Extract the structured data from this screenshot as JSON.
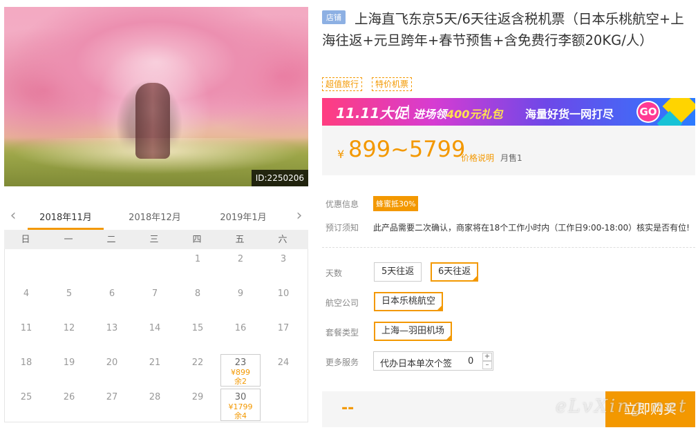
{
  "hero": {
    "id_label": "ID:2250206"
  },
  "calendar": {
    "months": [
      "2018年11月",
      "2018年12月",
      "2019年1月"
    ],
    "active_month": "2018年11月",
    "weekdays": [
      "日",
      "一",
      "二",
      "三",
      "四",
      "五",
      "六"
    ],
    "offset": 4,
    "days": [
      {
        "d": "1"
      },
      {
        "d": "2"
      },
      {
        "d": "3"
      },
      {
        "d": "4"
      },
      {
        "d": "5"
      },
      {
        "d": "6"
      },
      {
        "d": "7"
      },
      {
        "d": "8"
      },
      {
        "d": "9"
      },
      {
        "d": "10"
      },
      {
        "d": "11"
      },
      {
        "d": "12"
      },
      {
        "d": "13"
      },
      {
        "d": "14"
      },
      {
        "d": "15"
      },
      {
        "d": "16"
      },
      {
        "d": "17"
      },
      {
        "d": "18"
      },
      {
        "d": "19"
      },
      {
        "d": "20"
      },
      {
        "d": "21"
      },
      {
        "d": "22"
      },
      {
        "d": "23",
        "price": "¥899",
        "stock": "余2"
      },
      {
        "d": "24"
      },
      {
        "d": "25"
      },
      {
        "d": "26"
      },
      {
        "d": "27"
      },
      {
        "d": "28"
      },
      {
        "d": "29"
      },
      {
        "d": "30",
        "price": "¥1799",
        "stock": "余4"
      }
    ]
  },
  "product": {
    "store_badge": "店铺",
    "title": "上海直飞东京5天/6天往返含税机票（日本乐桃航空+上海往返+元旦跨年+春节预售+含免费行李额20KG/人）",
    "tags": [
      "超值旅行",
      "特价机票"
    ]
  },
  "promo": {
    "big": "11.11大促",
    "mid_prefix": "进场领",
    "mid_amount": "400元礼包",
    "tail": "海量好货一网打尽",
    "go": "GO"
  },
  "price": {
    "currency": "¥",
    "range": "899~5799",
    "explain": "价格说明",
    "sold": "月售1"
  },
  "discount": {
    "label": "优惠信息",
    "badge": "蜂蜜抵30%"
  },
  "notice": {
    "label": "预订须知",
    "text": "此产品需要二次确认，商家将在18个工作小时内（工作日9:00-18:00）核实是否有位!"
  },
  "options": {
    "days": {
      "label": "天数",
      "items": [
        "5天往返",
        "6天往返"
      ],
      "selected": "6天往返"
    },
    "airline": {
      "label": "航空公司",
      "items": [
        "日本乐桃航空"
      ],
      "selected": "日本乐桃航空"
    },
    "package": {
      "label": "套餐类型",
      "items": [
        "上海—羽田机场"
      ],
      "selected": "上海—羽田机场"
    },
    "service": {
      "label": "更多服务",
      "name": "代办日本单次个签",
      "qty": "0",
      "plus": "+",
      "minus": "–"
    }
  },
  "bottom": {
    "total": "--",
    "buy": "立即购买",
    "watermark": "eLvXing.net"
  },
  "colors": {
    "accent": "#f39800",
    "badge_blue": "#8db0e3"
  }
}
